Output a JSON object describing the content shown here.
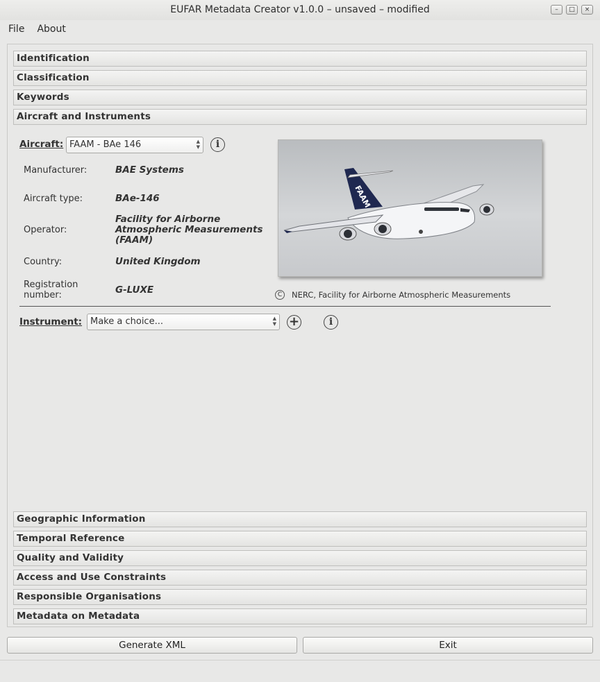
{
  "window": {
    "title": "EUFAR Metadata Creator v1.0.0 – unsaved – modified",
    "minimize": "–",
    "maximize": "□",
    "close": "×"
  },
  "menu": [
    "File",
    "About"
  ],
  "sections_top": [
    "Identification",
    "Classification",
    "Keywords",
    "Aircraft and Instruments"
  ],
  "aircraft": {
    "label": "Aircraft:",
    "selected": "FAAM - BAe 146",
    "fields": [
      {
        "label": "Manufacturer:",
        "value": "BAE Systems"
      },
      {
        "label": "Aircraft type:",
        "value": "BAe-146"
      },
      {
        "label": "Operator:",
        "value": "Facility for Airborne Atmospheric Measurements (FAAM)"
      },
      {
        "label": "Country:",
        "value": "United Kingdom"
      },
      {
        "label": "Registration number:",
        "value": "G-LUXE"
      }
    ],
    "photo_tail_text": "FAAM",
    "photo_credit": "NERC, Facility for Airborne Atmospheric Measurements"
  },
  "instrument": {
    "label": "Instrument:",
    "placeholder": "Make a choice..."
  },
  "sections_bottom": [
    "Geographic Information",
    "Temporal Reference",
    "Quality and Validity",
    "Access and Use Constraints",
    "Responsible Organisations",
    "Metadata on Metadata"
  ],
  "buttons": {
    "generate": "Generate XML",
    "exit": "Exit"
  },
  "icons": {
    "info": "i",
    "add": "+",
    "copyright": "C"
  }
}
